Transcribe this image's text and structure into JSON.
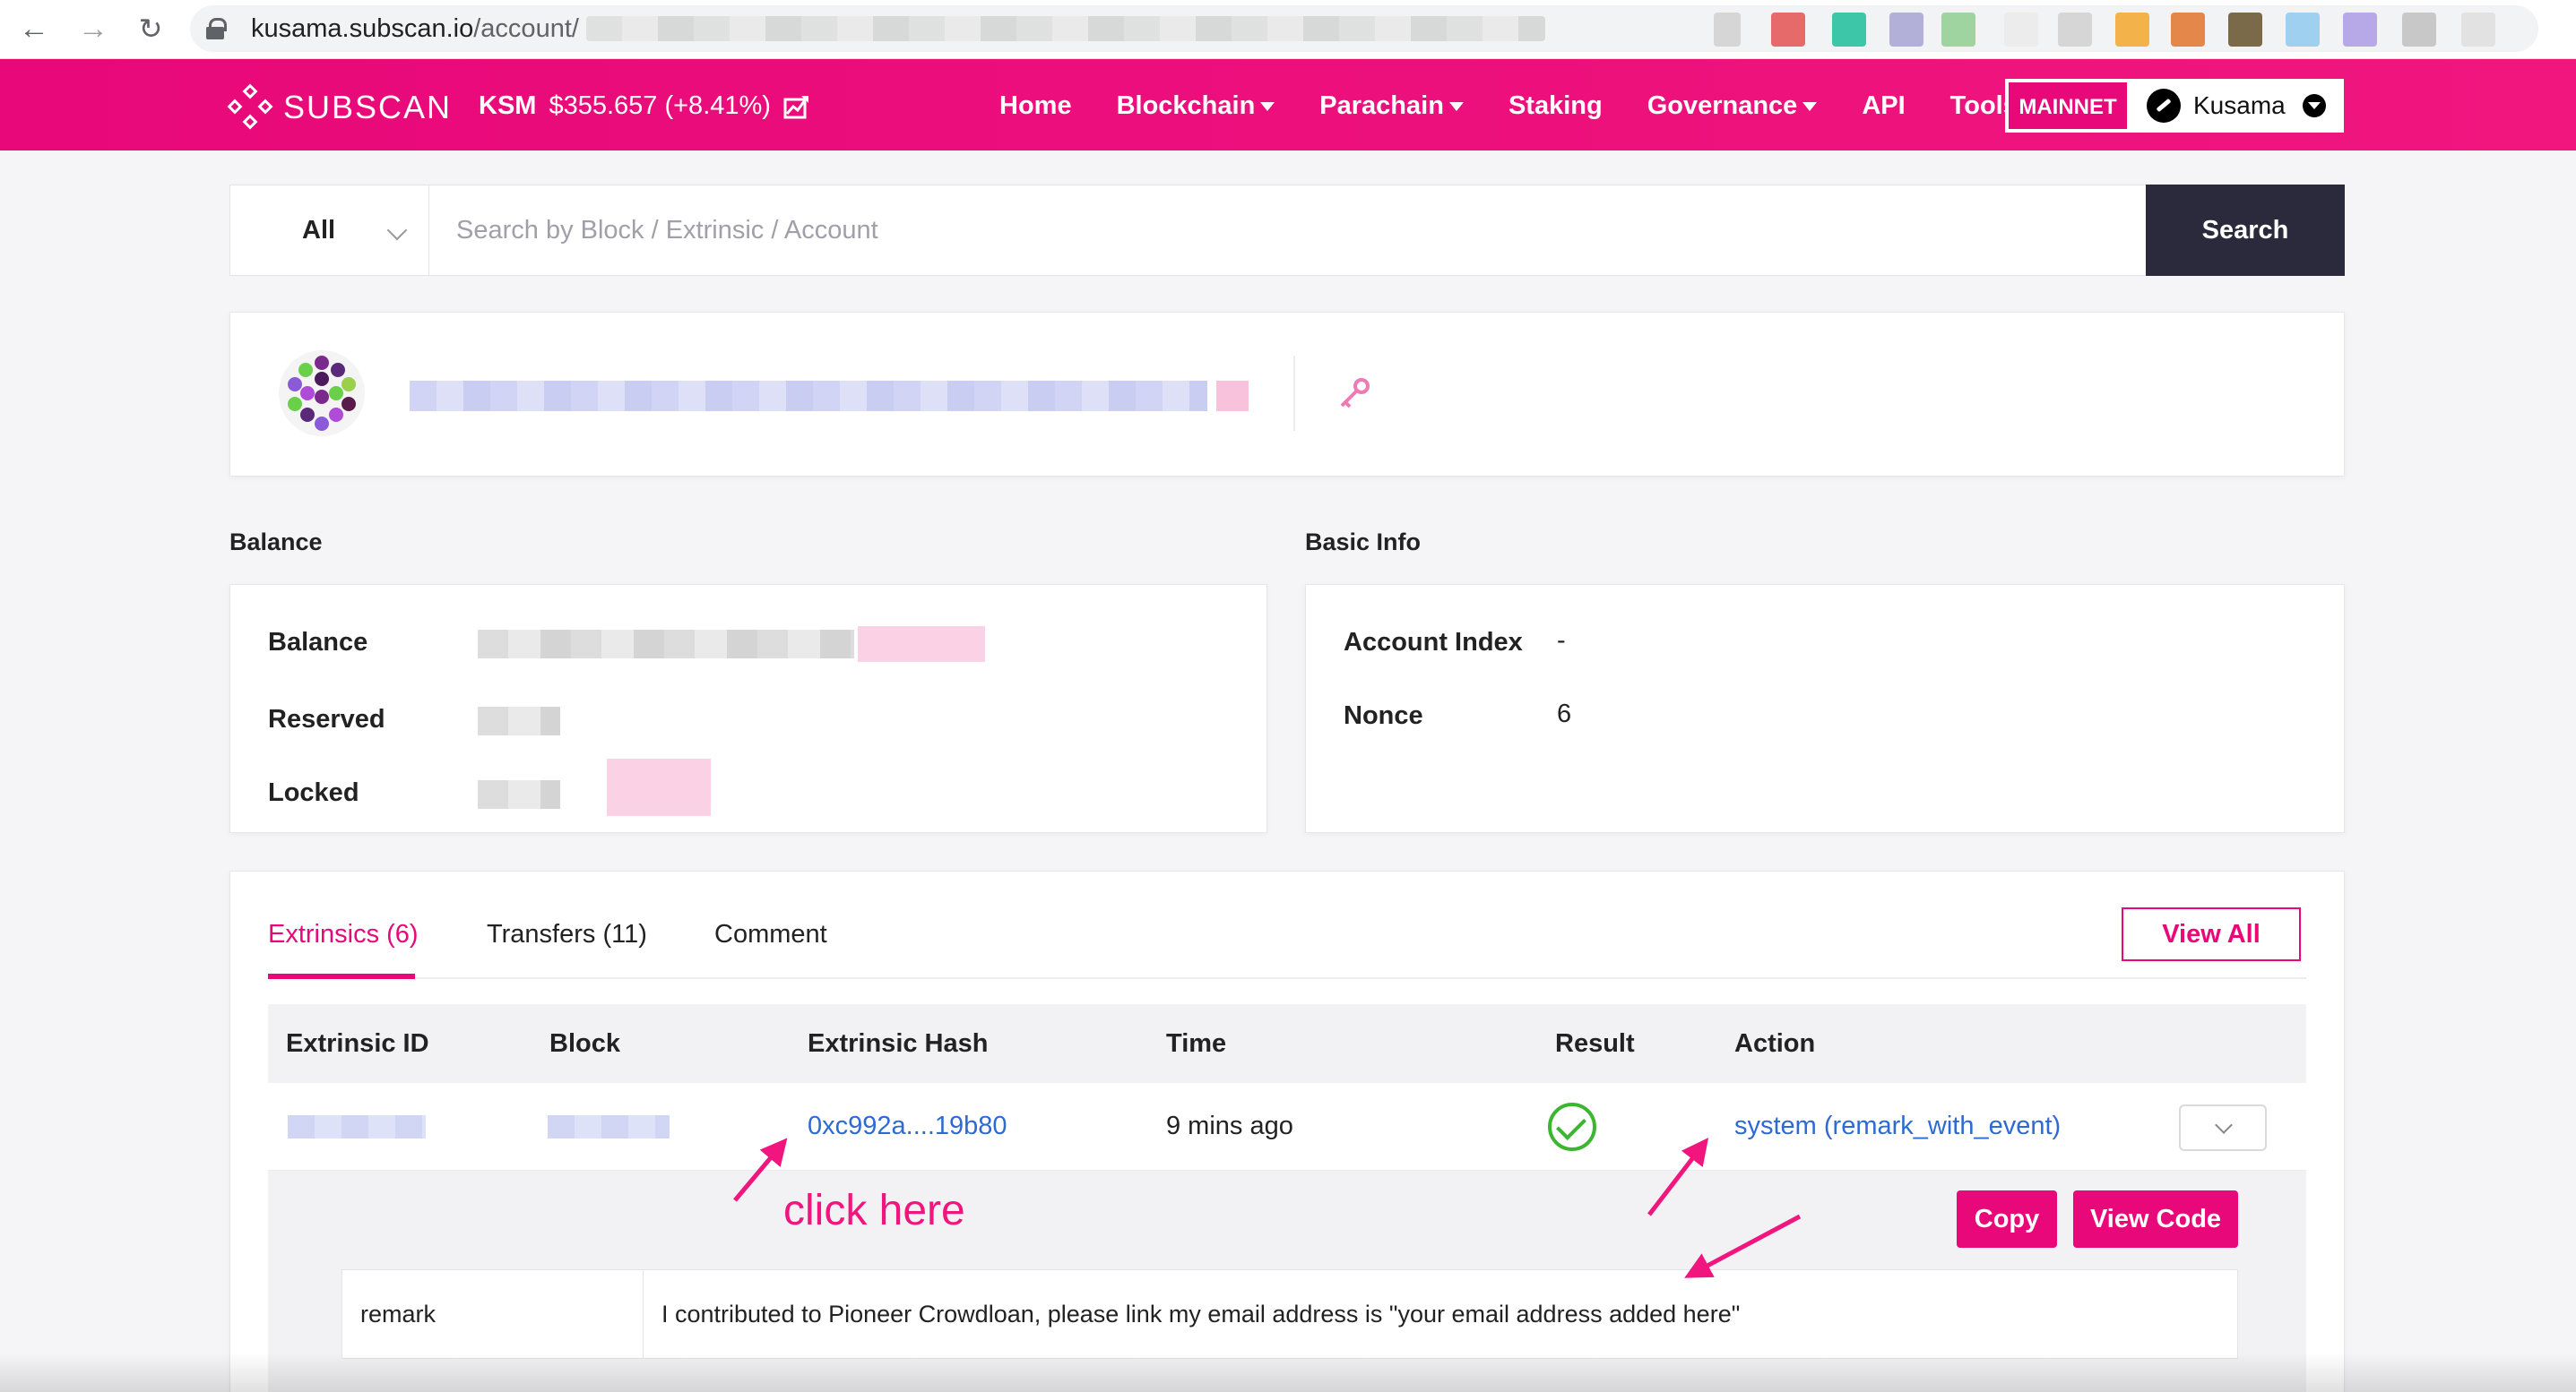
{
  "browser": {
    "url_host": "kusama.subscan.io",
    "url_path": "/account/",
    "back_icon": "arrow-left-icon",
    "forward_icon": "arrow-right-icon",
    "reload_icon": "reload-icon",
    "lock_icon": "lock-icon"
  },
  "header": {
    "logo_text": "SUBSCAN",
    "token_symbol": "KSM",
    "token_price": "$355.657 (+8.41%)",
    "nav": [
      {
        "label": "Home",
        "dropdown": false
      },
      {
        "label": "Blockchain",
        "dropdown": true
      },
      {
        "label": "Parachain",
        "dropdown": true
      },
      {
        "label": "Staking",
        "dropdown": false
      },
      {
        "label": "Governance",
        "dropdown": true
      },
      {
        "label": "API",
        "dropdown": false
      },
      {
        "label": "Tools",
        "dropdown": true
      }
    ],
    "network_badge": "MAINNET",
    "chain_name": "Kusama"
  },
  "search": {
    "filter": "All",
    "placeholder": "Search by Block / Extrinsic / Account",
    "button": "Search"
  },
  "balance": {
    "title": "Balance",
    "rows": [
      {
        "label": "Balance"
      },
      {
        "label": "Reserved"
      },
      {
        "label": "Locked"
      }
    ]
  },
  "basic_info": {
    "title": "Basic Info",
    "account_index_label": "Account Index",
    "account_index_value": "-",
    "nonce_label": "Nonce",
    "nonce_value": "6"
  },
  "extrinsics": {
    "tabs": [
      "Extrinsics (6)",
      "Transfers (11)",
      "Comment"
    ],
    "active_tab": 0,
    "view_all": "View All",
    "columns": [
      "Extrinsic ID",
      "Block",
      "Extrinsic Hash",
      "Time",
      "Result",
      "Action"
    ],
    "row": {
      "hash": "0xc992a....19b80",
      "time": "9 mins ago",
      "action": "system (remark_with_event)"
    },
    "detail": {
      "copy_button": "Copy",
      "view_code_button": "View Code",
      "param_key": "remark",
      "param_value": "I contributed to Pioneer Crowdloan, please link my email address is \"your email address added here\""
    }
  },
  "annotation": {
    "text": "click here",
    "color": "#f0167e"
  },
  "colors": {
    "brand": "#e8087a",
    "link": "#2d6ad3",
    "success": "#3cb531",
    "dark_button": "#2a2a3c"
  }
}
